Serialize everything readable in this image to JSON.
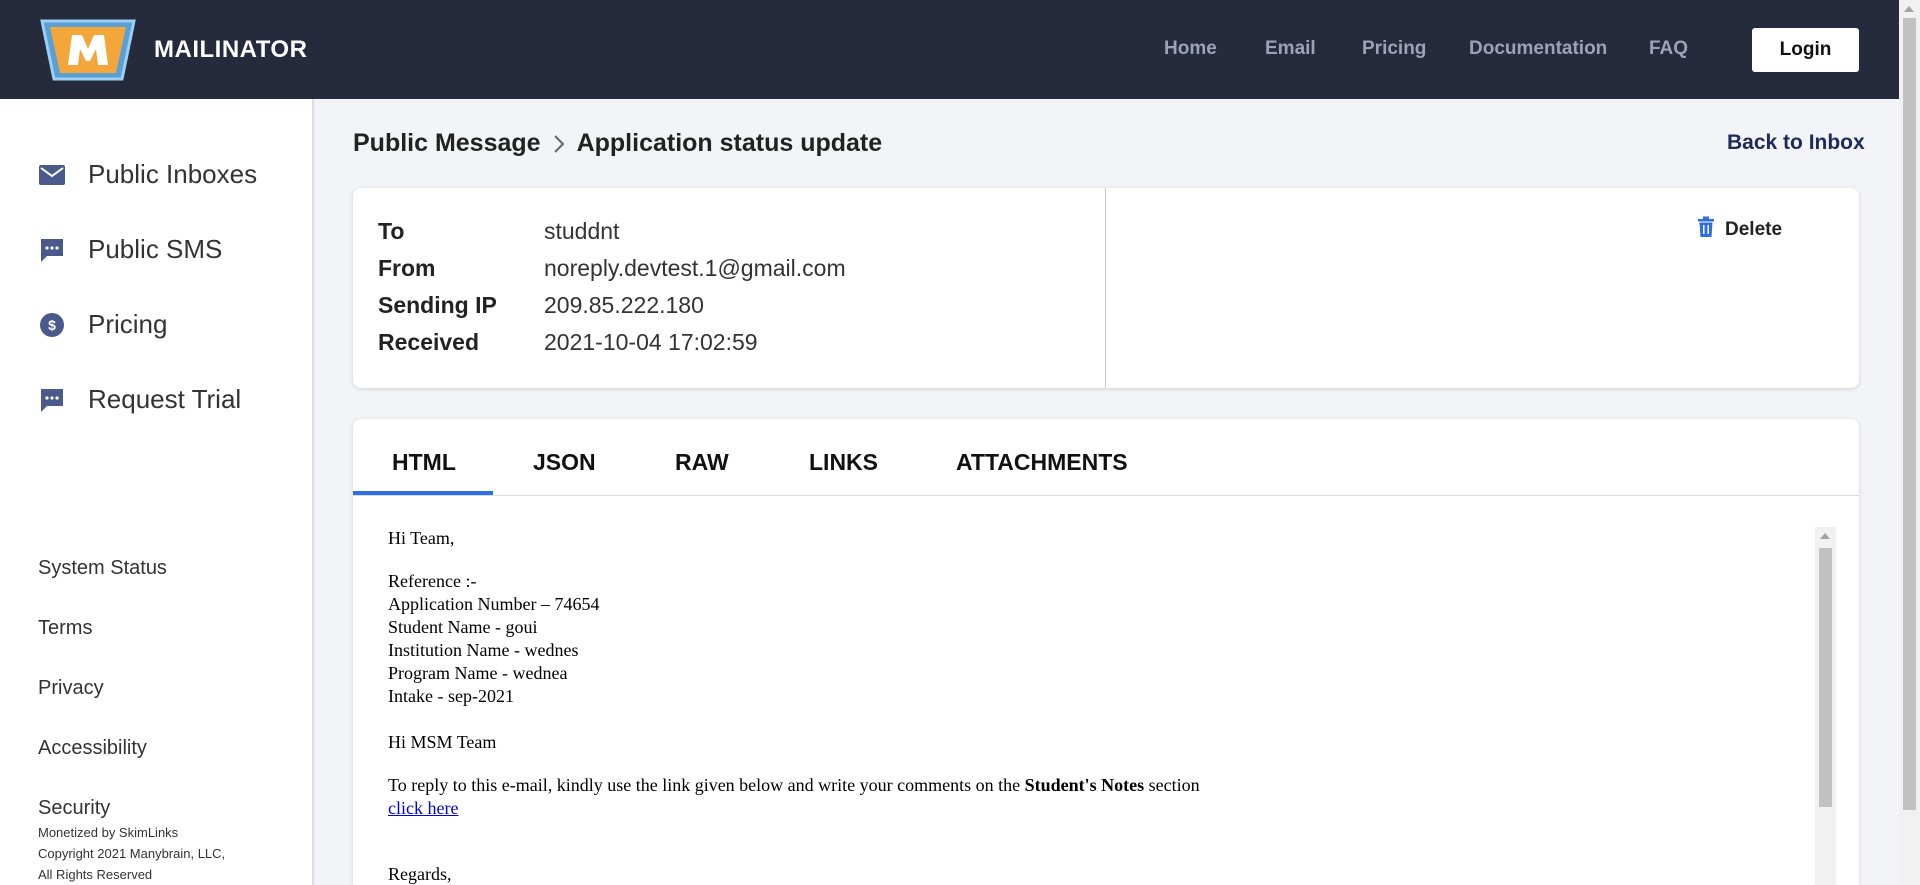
{
  "header": {
    "brand": "MAILINATOR",
    "nav": [
      "Home",
      "Email",
      "Pricing",
      "Documentation",
      "FAQ"
    ],
    "login_label": "Login"
  },
  "sidebar": {
    "items": [
      {
        "label": "Public Inboxes",
        "icon": "envelope-icon"
      },
      {
        "label": "Public SMS",
        "icon": "chat-icon"
      },
      {
        "label": "Pricing",
        "icon": "dollar-circle-icon"
      },
      {
        "label": "Request Trial",
        "icon": "chat-icon"
      }
    ],
    "footer_links": [
      "System Status",
      "Terms",
      "Privacy",
      "Accessibility",
      "Security"
    ],
    "monetized": "Monetized by SkimLinks",
    "copyright": "Copyright 2021 Manybrain, LLC,",
    "rights": "All Rights Reserved"
  },
  "breadcrumb": {
    "parent": "Public Message",
    "current": "Application status update"
  },
  "back_to_inbox": "Back to Inbox",
  "message_meta": {
    "rows": [
      {
        "key": "To",
        "value": "studdnt"
      },
      {
        "key": "From",
        "value": "noreply.devtest.1@gmail.com"
      },
      {
        "key": "Sending IP",
        "value": "209.85.222.180"
      },
      {
        "key": "Received",
        "value": "2021-10-04 17:02:59"
      }
    ],
    "delete_label": "Delete"
  },
  "tabs": {
    "items": [
      "HTML",
      "JSON",
      "RAW",
      "LINKS",
      "ATTACHMENTS"
    ],
    "active": "HTML"
  },
  "email_body": {
    "greeting": "Hi Team,",
    "reference": "Reference :-",
    "application_number": "Application Number – 74654",
    "student_name": "Student Name - goui",
    "institution_name": "Institution Name - wednes",
    "program_name": "Program Name - wednea",
    "intake": "Intake - sep-2021",
    "msm_greeting": "Hi MSM Team",
    "reply_text": "To reply to this e-mail, kindly use the link given below and write your comments on the",
    "reply_bold": "Student's Notes",
    "reply_end": "section",
    "link_text": "click here",
    "regards": "Regards,"
  },
  "colors": {
    "header_bg": "#252a3d",
    "sidebar_icon": "#4a5a8c",
    "tab_accent": "#2f6fe4",
    "delete_icon": "#2f6fe4"
  }
}
